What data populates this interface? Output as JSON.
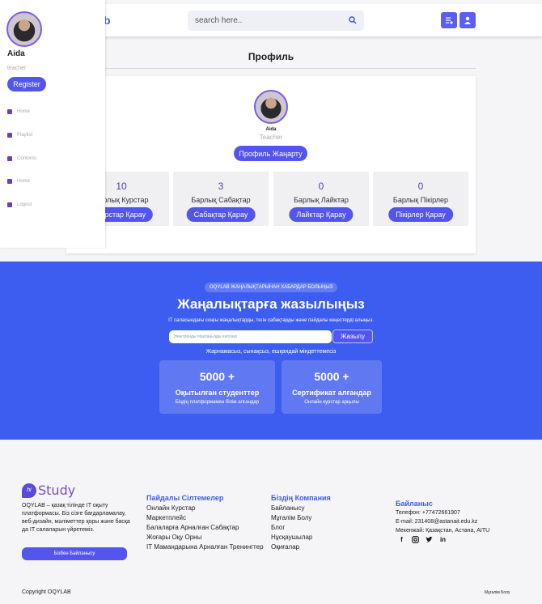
{
  "header": {
    "logo_partial": "b",
    "search_placeholder": "search here.."
  },
  "sidebar": {
    "name": "Aida",
    "role": "teacher",
    "register_label": "Register",
    "items": [
      {
        "label": "Home",
        "icon": "home-icon"
      },
      {
        "label": "Playlist",
        "icon": "playlist-icon"
      },
      {
        "label": "Contents",
        "icon": "contents-icon"
      },
      {
        "label": "Home",
        "icon": "home-icon"
      },
      {
        "label": "Logout",
        "icon": "logout-icon"
      }
    ]
  },
  "main": {
    "title": "Профиль",
    "profile": {
      "name": "Aida",
      "role": "Teacher",
      "update_label": "Профиль Жаңарту"
    },
    "stats": [
      {
        "value": "10",
        "label": "Барлық Курстар",
        "button": "Курстар Қарау"
      },
      {
        "value": "3",
        "label": "Барлық Сабақтар",
        "button": "Сабақтар Қарау"
      },
      {
        "value": "0",
        "label": "Барлық Лайктар",
        "button": "Лайктар Қарау"
      },
      {
        "value": "0",
        "label": "Барлық Пікірлер",
        "button": "Пікірлер Қарау"
      }
    ]
  },
  "newsletter": {
    "badge": "OQYLAB ЖАҢАЛЫҚТАРЫНАН ХАБАРДАР БОЛЫҢЫЗ",
    "title": "Жаңалықтарға жазылыңыз",
    "subtitle": "IT саласындағы соңғы жаңалықтарды, тегін сабақтарды және пайдалы кеңестерді алыңыз.",
    "input_placeholder": "Электронды поштаңызды енгізіңіз",
    "button": "Жазылу",
    "note": "Жарнамасыз, сынақсыз, ешқандай міндеттемесіз",
    "stats": [
      {
        "number": "5000 +",
        "title": "Оқытылған студенттер",
        "desc": "Біздің платформамен білім алғандар"
      },
      {
        "number": "5000 +",
        "title": "Сертификат алғандар",
        "desc": "Онлайн курстар арқылы"
      }
    ]
  },
  "footer": {
    "logo_mark": "hi",
    "logo_word": "Study",
    "description": "OQYLAB – қазақ тілінде IT оқыту платформасы. Біз сізге бағдарламалау, веб-дизайн, мәліметтер қоры және басқа да IT салаларын үйретеміз.",
    "contact_button": "Бізбен Байланысу",
    "columns": [
      {
        "title": "Пайдалы Сілтемелер",
        "links": [
          "Онлайн Курстар",
          "Маркетплейс",
          "Балаларға Арналған Сабақтар",
          "Жоғары Оқу Орны",
          "IT Мамандарына Арналған Тренингтер"
        ]
      },
      {
        "title": "Біздің Компания",
        "links": [
          "Байланысу",
          "Мұғалім Болу",
          "Блог",
          "Нұсқаушылар",
          "Оқиғалар"
        ]
      }
    ],
    "contact": {
      "title": "Байланыс",
      "phone": "Телефон: +77472661907",
      "email": "E-mail: 231408@astanait.edu.kz",
      "address": "Мекенжай: Қазақстан, Астана, AITU"
    },
    "copyright": "Copyright OQYLAB",
    "teach_link": "Мұғалім Болу"
  }
}
